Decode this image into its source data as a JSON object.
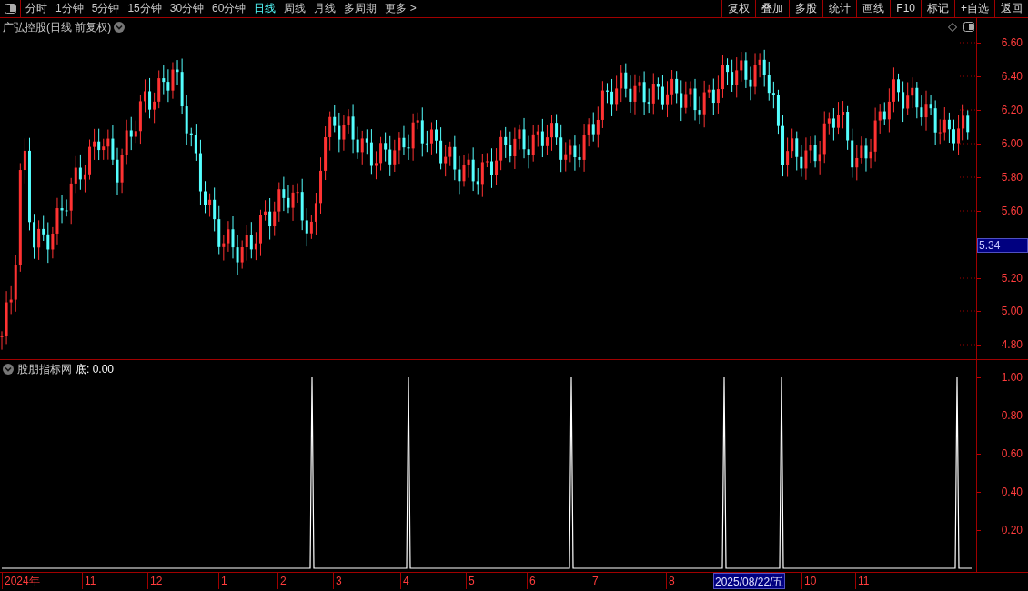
{
  "toolbar": {
    "periods": [
      {
        "label": "分时",
        "selected": false
      },
      {
        "label": "1分钟",
        "selected": false
      },
      {
        "label": "5分钟",
        "selected": false
      },
      {
        "label": "15分钟",
        "selected": false
      },
      {
        "label": "30分钟",
        "selected": false
      },
      {
        "label": "60分钟",
        "selected": false
      },
      {
        "label": "日线",
        "selected": true
      },
      {
        "label": "周线",
        "selected": false
      },
      {
        "label": "月线",
        "selected": false
      },
      {
        "label": "多周期",
        "selected": false
      },
      {
        "label": "更多 >",
        "selected": false
      }
    ],
    "buttons": [
      "复权",
      "叠加",
      "多股",
      "统计",
      "画线",
      "F10",
      "标记",
      "+自选",
      "返回"
    ]
  },
  "price_panel": {
    "title": "广弘控股(日线 前复权)",
    "ticks": [
      "6.60",
      "6.40",
      "6.20",
      "6.00",
      "5.80",
      "5.60",
      "5.20",
      "5.00",
      "4.80"
    ],
    "current_price": "5.34"
  },
  "indicator_panel": {
    "name": "股朋指标网",
    "reading": "底: 0.00",
    "ticks": [
      "1.00",
      "0.80",
      "0.60",
      "0.40",
      "0.20"
    ]
  },
  "time_axis": [
    {
      "label": "2024年",
      "selected": false
    },
    {
      "label": "11",
      "selected": false
    },
    {
      "label": "12",
      "selected": false
    },
    {
      "label": "1",
      "selected": false
    },
    {
      "label": "2",
      "selected": false
    },
    {
      "label": "3",
      "selected": false
    },
    {
      "label": "4",
      "selected": false
    },
    {
      "label": "5",
      "selected": false
    },
    {
      "label": "6",
      "selected": false
    },
    {
      "label": "7",
      "selected": false
    },
    {
      "label": "8",
      "selected": false
    },
    {
      "label": "2025/08/22/五",
      "selected": true
    },
    {
      "label": "10",
      "selected": false
    },
    {
      "label": "11",
      "selected": false
    }
  ]
}
